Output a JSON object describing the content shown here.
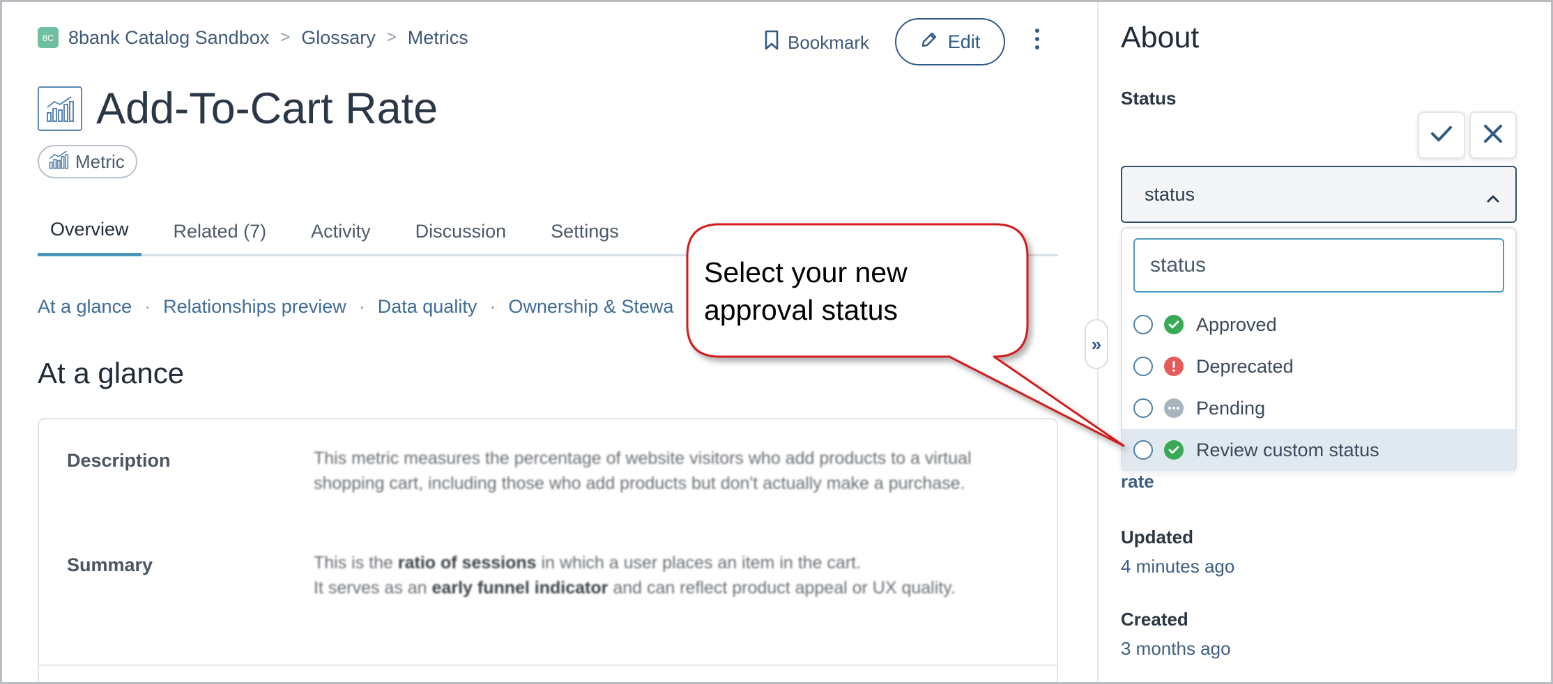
{
  "breadcrumb": {
    "org_initials": "8C",
    "items": [
      "8bank Catalog Sandbox",
      "Glossary",
      "Metrics"
    ],
    "separator": ">"
  },
  "header": {
    "bookmark_label": "Bookmark",
    "edit_label": "Edit",
    "title": "Add-To-Cart Rate",
    "type_chip": "Metric"
  },
  "tabs": [
    {
      "label": "Overview",
      "active": true
    },
    {
      "label": "Related (7)",
      "active": false
    },
    {
      "label": "Activity",
      "active": false
    },
    {
      "label": "Discussion",
      "active": false
    },
    {
      "label": "Settings",
      "active": false
    }
  ],
  "jump_links": [
    "At a glance",
    "Relationships preview",
    "Data quality",
    "Ownership & Stewa"
  ],
  "jump_separator": "·",
  "section": {
    "heading": "At a glance",
    "description_label": "Description",
    "description_text": "This metric measures the percentage of website visitors who add products to a virtual shopping cart, including those who add products but don't actually make a purchase.",
    "summary_label": "Summary",
    "summary_part1": "This is the ",
    "summary_bold1": "ratio of sessions",
    "summary_part2": " in which a user places an item in the cart.",
    "summary_part3": "It serves as an ",
    "summary_bold2": "early funnel indicator",
    "summary_part4": " and can reflect product appeal or UX quality."
  },
  "about": {
    "title": "About",
    "status_label": "Status",
    "select_value": "status",
    "search_placeholder": "status",
    "options": [
      {
        "label": "Approved",
        "icon": "check-circle-icon",
        "color": "#3aa956"
      },
      {
        "label": "Deprecated",
        "icon": "alert-circle-icon",
        "color": "#e45b5b"
      },
      {
        "label": "Pending",
        "icon": "ellipsis-circle-icon",
        "color": "#a9b3bf"
      },
      {
        "label": "Review custom status",
        "icon": "check-circle-icon",
        "color": "#3aa956"
      }
    ],
    "partial_value": "rate",
    "updated_label": "Updated",
    "updated_value": "4 minutes ago",
    "created_label": "Created",
    "created_value": "3 months ago"
  },
  "callout": {
    "line1": "Select your new",
    "line2": "approval status"
  },
  "colors": {
    "accent": "#2f5a86",
    "tab_indicator": "#4a94b8",
    "callout_border": "#d01f1f"
  }
}
